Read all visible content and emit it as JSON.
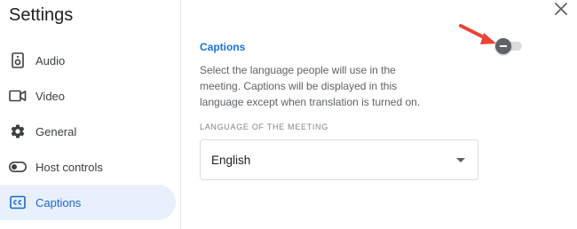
{
  "sidebar": {
    "title": "Settings",
    "items": [
      {
        "label": "Audio",
        "icon": "speaker-icon"
      },
      {
        "label": "Video",
        "icon": "video-camera-icon"
      },
      {
        "label": "General",
        "icon": "gear-icon"
      },
      {
        "label": "Host controls",
        "icon": "toggle-icon"
      },
      {
        "label": "Captions",
        "icon": "closed-captions-icon",
        "active": true
      }
    ]
  },
  "captions": {
    "title": "Captions",
    "description": "Select the language people will use in the meeting. Captions will be displayed in this language except when translation is turned on.",
    "toggle_on": false,
    "language_label": "LANGUAGE OF THE MEETING",
    "language_value": "English"
  },
  "colors": {
    "accent": "#1a73e8",
    "active_bg": "#e8f0fe",
    "annotation_arrow": "#ea4335"
  }
}
